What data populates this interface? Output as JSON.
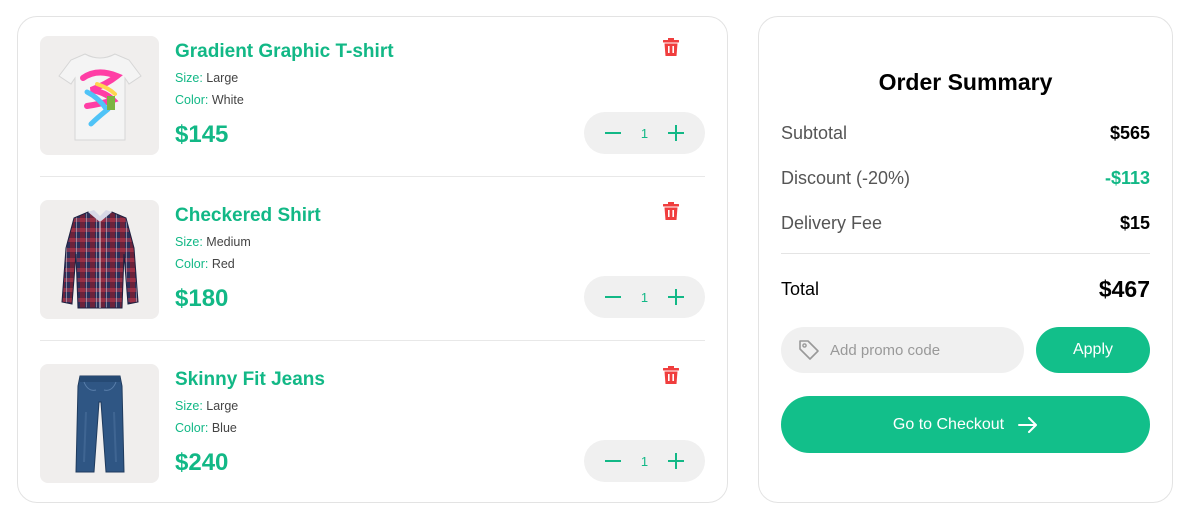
{
  "cart": {
    "items": [
      {
        "name": "Gradient Graphic T-shirt",
        "size_label": "Size:",
        "size": "Large",
        "color_label": "Color:",
        "color": "White",
        "price": "$145",
        "quantity": "1",
        "image_icon": "tshirt-image"
      },
      {
        "name": "Checkered Shirt",
        "size_label": "Size:",
        "size": "Medium",
        "color_label": "Color:",
        "color": "Red",
        "price": "$180",
        "quantity": "1",
        "image_icon": "shirt-image"
      },
      {
        "name": "Skinny Fit Jeans",
        "size_label": "Size:",
        "size": "Large",
        "color_label": "Color:",
        "color": "Blue",
        "price": "$240",
        "quantity": "1",
        "image_icon": "jeans-image"
      }
    ]
  },
  "summary": {
    "title": "Order Summary",
    "subtotal_label": "Subtotal",
    "subtotal": "$565",
    "discount_label": "Discount (-20%)",
    "discount": "-$113",
    "delivery_label": "Delivery Fee",
    "delivery": "$15",
    "total_label": "Total",
    "total": "$467",
    "promo_placeholder": "Add promo code",
    "apply_label": "Apply",
    "checkout_label": "Go to Checkout"
  },
  "colors": {
    "accent": "#12bf8a",
    "delete": "#f03e3e",
    "panel_bg": "#f0f0f0"
  }
}
